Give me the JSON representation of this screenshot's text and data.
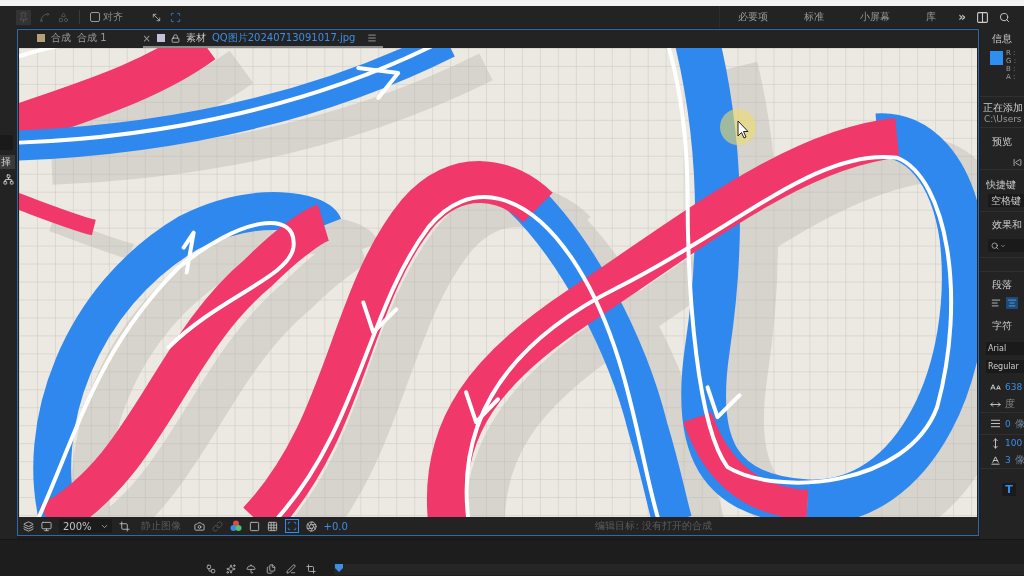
{
  "toolbar": {
    "snap": {
      "label": "对齐",
      "checked": false
    },
    "workspaces": [
      {
        "label": "必要项",
        "selected": false
      },
      {
        "label": "标准",
        "selected": false
      },
      {
        "label": "小屏幕",
        "selected": false
      },
      {
        "label": "库",
        "selected": false
      }
    ],
    "overflow": "»"
  },
  "left_panel": {
    "tab": "择"
  },
  "viewer": {
    "tabs": [
      {
        "kind": "composition",
        "label": "合成",
        "name": "合成 1",
        "color": "#b4a276",
        "selected": false
      },
      {
        "kind": "footage",
        "close": "×",
        "label": "素材",
        "name": "QQ图片20240713091017.jpg",
        "color": "#c4c0dc",
        "selected": true
      }
    ],
    "footer": {
      "zoom": "200%",
      "still": {
        "label": "静止图像",
        "disabled": true
      },
      "fast_previews": {
        "on": true
      },
      "exposure": "+0.0",
      "status": "编辑目标: 没有打开的合成"
    }
  },
  "info": {
    "title": "信息",
    "color": "#2f8ff0",
    "channels": [
      "R :",
      "G :",
      "B :",
      "A :"
    ],
    "status": "正在添加",
    "path": "C:\\Users"
  },
  "preview": {
    "title": "预览"
  },
  "shortcut": {
    "title": "快捷键",
    "value": "空格键"
  },
  "effects": {
    "title": "效果和"
  },
  "paragraph": {
    "title": "段落",
    "align": [
      {
        "selected": false
      },
      {
        "selected": true
      }
    ]
  },
  "character": {
    "title": "字符",
    "font": "Arial",
    "style": "Regular",
    "properties": [
      {
        "kind": "size",
        "value": "638"
      },
      {
        "kind": "tracking",
        "value": "度"
      },
      {
        "kind": "leading",
        "value": "0",
        "unit": "像"
      },
      {
        "kind": "vertical_scale",
        "value": "100"
      },
      {
        "kind": "baseline",
        "value": "3",
        "unit": "像"
      }
    ],
    "faux_bold": {
      "label": "T",
      "selected": true
    }
  }
}
